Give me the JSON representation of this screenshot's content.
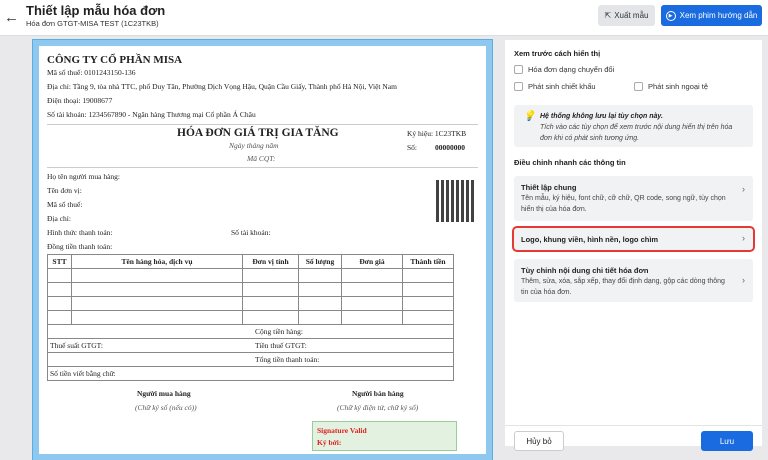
{
  "header": {
    "title": "Thiết lập mẫu hóa đơn",
    "subtitle": "Hóa đơn GTGT-MISA TEST (1C23TKB)",
    "export_label": "Xuất mẫu",
    "video_label": "Xem phim hướng dẫn"
  },
  "invoice": {
    "company": "CÔNG TY CỔ PHẦN MISA",
    "tax_code": "Mã số thuế: 0101243150-136",
    "address": "Địa chỉ: Tầng 9, tòa nhà TTC, phố Duy Tân, Phường Dịch Vọng Hậu, Quận Cầu Giấy, Thành phố Hà Nội, Việt Nam",
    "phone": "Điện thoại: 19008677",
    "account": "Số tài khoản: 1234567890 - Ngân hàng Thương mại Cổ phần Á Châu",
    "title": "HÓA ĐƠN GIÁ TRỊ GIA TĂNG",
    "date": "Ngày   tháng   năm",
    "cqt": "Mã CQT:",
    "symbol_label": "Ký hiệu:",
    "symbol": "1C23TKB",
    "number_label": "Số:",
    "number": "00000000",
    "buyer_fields": [
      "Họ tên người mua hàng:",
      "Tên đơn vị:",
      "Mã số thuế:",
      "Địa chỉ:"
    ],
    "payment_method": "Hình thức thanh toán:",
    "buyer_account": "Số tài khoản:",
    "currency": "Đồng tiền thanh toán:",
    "columns": [
      "STT",
      "Tên hàng hóa, dịch vụ",
      "Đơn vị tính",
      "Số lượng",
      "Đơn giá",
      "Thành tiền"
    ],
    "subtotal": "Cộng tiền hàng:",
    "vat_rate": "Thuế suất GTGT:",
    "vat_amount": "Tiền thuế GTGT:",
    "total": "Tổng tiền thanh toán:",
    "in_words": "Số tiền viết bằng chữ:",
    "buyer_sign": "Người mua hàng",
    "buyer_sign_note": "(Chữ ký số (nếu có))",
    "seller_sign": "Người bán hàng",
    "seller_sign_note": "(Chữ ký điện tử, chữ ký số)",
    "signature_valid": "Signature Valid",
    "signed_by": "Ký bởi:"
  },
  "panel": {
    "preview_title": "Xem trước cách hiển thị",
    "checkboxes": [
      "Hóa đơn dạng chuyển đổi",
      "Phát sinh chiết khấu",
      "Phát sinh ngoại tệ"
    ],
    "note_title": "Hệ thống không lưu lại tùy chọn này.",
    "note_text": "Tích vào các tùy chọn để xem trước nội dung hiển thị trên hóa đơn khi có phát sinh tương ứng.",
    "quick_title": "Điều chỉnh nhanh các thông tin",
    "cards": [
      {
        "title": "Thiết lập chung",
        "desc": "Tên mẫu, ký hiệu, font chữ, cỡ chữ, QR code, song ngữ, tùy chọn hiển thị của hóa đơn."
      },
      {
        "title": "Logo, khung viền, hình nền, logo chìm"
      },
      {
        "title": "Tùy chỉnh nội dung chi tiết hóa đơn",
        "desc": "Thêm, sửa, xóa, sắp xếp, thay đổi định dạng, gộp các dòng thông tin của hóa đơn."
      }
    ],
    "cancel_label": "Hủy bỏ",
    "save_label": "Lưu"
  },
  "colors": {
    "accent": "#1a6be0",
    "highlight": "#e53935"
  }
}
